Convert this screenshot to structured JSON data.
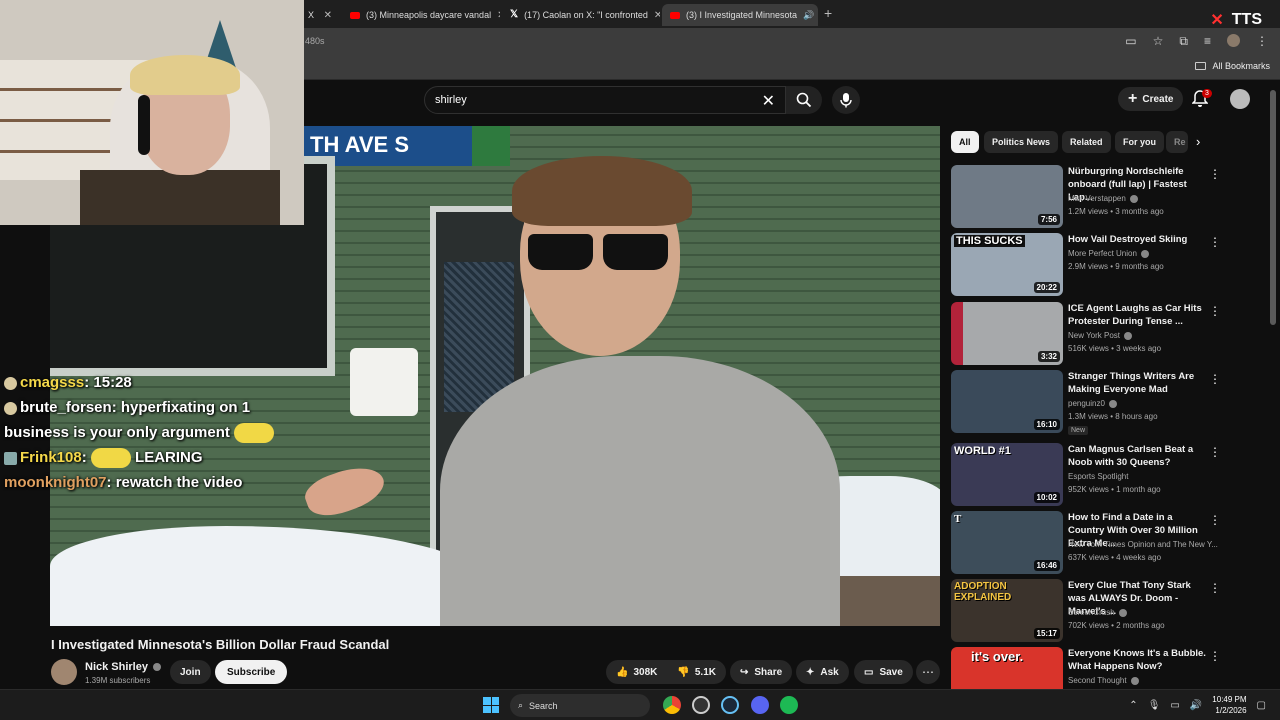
{
  "browser": {
    "tabs": [
      {
        "label": "X",
        "icon": "x-icon",
        "active": false
      },
      {
        "label": "(3) Minneapolis daycare vandal",
        "icon": "youtube-icon",
        "active": false
      },
      {
        "label": "(17) Caolan on X: \"I confronted",
        "icon": "x-icon",
        "active": false
      },
      {
        "label": "(3) I Investigated Minnesota",
        "icon": "youtube-icon",
        "active": true
      }
    ],
    "url_fragment": "480s",
    "all_bookmarks": "All Bookmarks",
    "tts_label": "TTS"
  },
  "youtube": {
    "search_value": "shirley",
    "create_label": "Create",
    "notification_count": "3"
  },
  "chat": [
    {
      "user": "cmagsss",
      "color": "#f5d94a",
      "msg": "15:28"
    },
    {
      "user": "brute_forsen",
      "color": "#ffffff",
      "msg": "hyperfixating on 1 business is your only argument"
    },
    {
      "user": "Frink108",
      "color": "#f5d94a",
      "msg": "LEARING"
    },
    {
      "user": "moonknight07",
      "color": "#e0a060",
      "msg": "rewatch the video"
    }
  ],
  "video": {
    "sign_text": "TH AVE S",
    "title": "I Investigated Minnesota's Billion Dollar Fraud Scandal",
    "channel": "Nick Shirley",
    "subscribers": "1.39M subscribers",
    "join_label": "Join",
    "subscribe_label": "Subscribe",
    "likes": "308K",
    "dislikes": "5.1K",
    "share_label": "Share",
    "ask_label": "Ask",
    "save_label": "Save"
  },
  "chips": [
    "All",
    "Politics News",
    "Related",
    "For you",
    "Re"
  ],
  "recommendations": [
    {
      "title": "Nürburgring Nordschleife onboard (full lap) | Fastest Lap...",
      "channel": "Max Verstappen",
      "verified": true,
      "meta": "1.2M views • 3 months ago",
      "duration": "7:56",
      "thumb_text": "",
      "thumb_color": "#6f7a86",
      "badge": ""
    },
    {
      "title": "How Vail Destroyed Skiing",
      "channel": "More Perfect Union",
      "verified": true,
      "meta": "2.9M views • 9 months ago",
      "duration": "20:22",
      "thumb_text": "THIS SUCKS",
      "thumb_color": "#9aa7b4",
      "badge": ""
    },
    {
      "title": "ICE Agent Laughs as Car Hits Protester During Tense ...",
      "channel": "New York Post",
      "verified": true,
      "meta": "516K views • 3 weeks ago",
      "duration": "3:32",
      "thumb_text": "",
      "thumb_color": "#a7a9ab",
      "badge": ""
    },
    {
      "title": "Stranger Things Writers Are Making Everyone Mad",
      "channel": "penguinz0",
      "verified": true,
      "meta": "1.3M views • 8 hours ago",
      "duration": "16:10",
      "thumb_text": "",
      "thumb_color": "#3a4a5a",
      "badge": "New"
    },
    {
      "title": "Can Magnus Carlsen Beat a Noob with 30 Queens?",
      "channel": "Esports Spotlight",
      "verified": false,
      "meta": "952K views • 1 month ago",
      "duration": "10:02",
      "thumb_text": "WORLD #1",
      "thumb_color": "#3a3a55",
      "badge": ""
    },
    {
      "title": "How to Find a Date in a Country With Over 30 Million Extra Me...",
      "channel": "New York Times Opinion and The New Y...",
      "verified": false,
      "meta": "637K views • 4 weeks ago",
      "duration": "16:46",
      "thumb_text": "T",
      "thumb_color": "#3d4d5a",
      "badge": ""
    },
    {
      "title": "Every Clue That Tony Stark was ALWAYS Dr. Doom - Marvel's ...",
      "channel": "ScreenCrush",
      "verified": true,
      "meta": "702K views • 2 months ago",
      "duration": "15:17",
      "thumb_text": "ADOPTION EXPLAINED",
      "thumb_color": "#3b332c",
      "badge": ""
    },
    {
      "title": "Everyone Knows It's a Bubble. What Happens Now?",
      "channel": "Second Thought",
      "verified": true,
      "meta": "",
      "duration": "",
      "thumb_text": "it's over.",
      "thumb_color": "#d9342b",
      "badge": ""
    }
  ],
  "taskbar": {
    "search_label": "Search",
    "time": "10:49 PM",
    "date": "1/2/2026"
  }
}
